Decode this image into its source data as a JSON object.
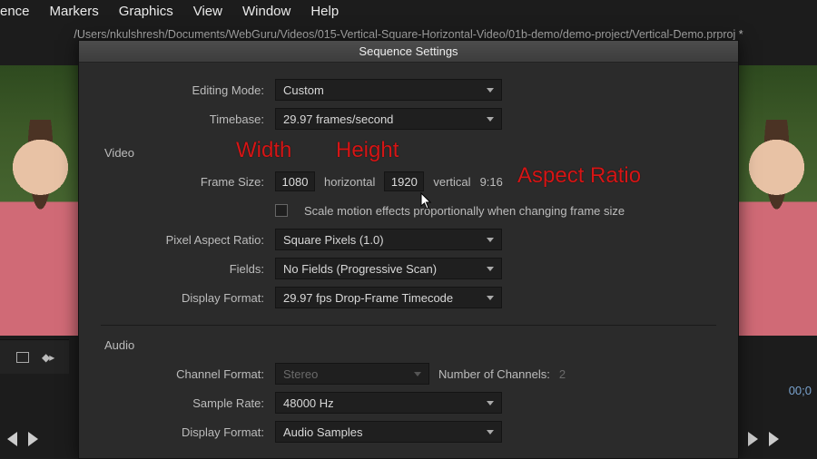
{
  "menu": [
    "ence",
    "Markers",
    "Graphics",
    "View",
    "Window",
    "Help"
  ],
  "path": "/Users/nkulshresh/Documents/WebGuru/Videos/015-Vertical-Square-Horizontal-Video/01b-demo/demo-project/Vertical-Demo.prproj *",
  "dialog_title": "Sequence Settings",
  "labels": {
    "editing_mode": "Editing Mode:",
    "timebase": "Timebase:",
    "frame_size": "Frame Size:",
    "horizontal": "horizontal",
    "vertical": "vertical",
    "ratio": "9:16",
    "checkbox": "Scale motion effects proportionally when changing frame size",
    "par": "Pixel Aspect Ratio:",
    "fields": "Fields:",
    "display_fmt": "Display Format:",
    "channel_fmt": "Channel Format:",
    "num_channels_lbl": "Number of Channels:",
    "sample_rate": "Sample Rate:",
    "a_display_fmt": "Display Format:"
  },
  "sections": {
    "video": "Video",
    "audio": "Audio"
  },
  "values": {
    "editing_mode": "Custom",
    "timebase": "29.97  frames/second",
    "width": "1080",
    "height": "1920",
    "par": "Square Pixels (1.0)",
    "fields": "No Fields (Progressive Scan)",
    "display_fmt": "29.97 fps Drop-Frame Timecode",
    "channel_fmt": "Stereo",
    "num_channels": "2",
    "sample_rate": "48000 Hz",
    "a_display_fmt": "Audio Samples"
  },
  "annotations": {
    "width": "Width",
    "height": "Height",
    "aspect": "Aspect Ratio"
  },
  "timecode": "00;0"
}
